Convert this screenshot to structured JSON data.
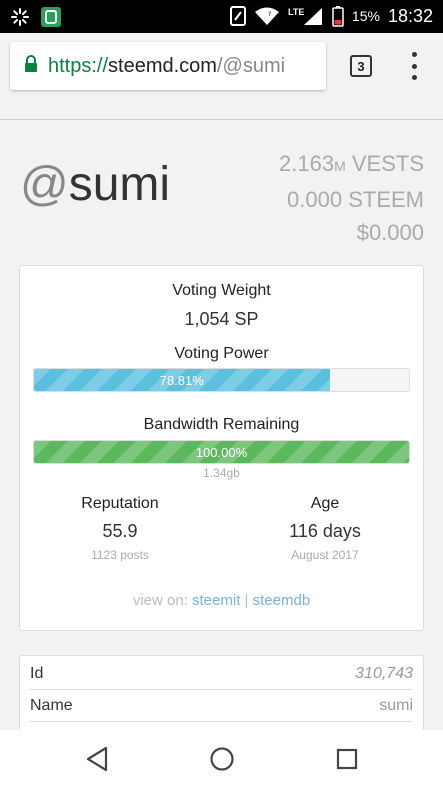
{
  "status_bar": {
    "battery_percent": "15%",
    "time": "18:32",
    "network": "LTE",
    "icons": [
      "loading-spinner-icon",
      "app-notification-icon",
      "nfc-icon",
      "wifi-icon",
      "lte-signal-icon",
      "battery-low-icon"
    ]
  },
  "browser": {
    "url_scheme": "https://",
    "url_host": "steemd.com",
    "url_path": "/@sumi",
    "tab_count": "3",
    "accent_color": "#0b8043"
  },
  "profile": {
    "at_sign": "@",
    "username": "sumi",
    "vests_value": "2.163",
    "vests_unit_small": "M",
    "vests_label": "VESTS",
    "steem": "0.000 STEEM",
    "usd": "$0.000"
  },
  "stats": {
    "voting_weight_label": "Voting Weight",
    "voting_weight_value": "1,054 SP",
    "voting_power_label": "Voting Power",
    "voting_power_text": "78.81%",
    "voting_power_fraction": 0.7881,
    "bandwidth_label": "Bandwidth Remaining",
    "bandwidth_text": "100.00%",
    "bandwidth_fraction": 1.0,
    "bandwidth_size": "1.34gb",
    "reputation_label": "Reputation",
    "reputation_value": "55.9",
    "reputation_sub": "1123 posts",
    "age_label": "Age",
    "age_value": "116 days",
    "age_sub": "August 2017",
    "view_on_prefix": "view on:",
    "link_steemit": "steemit",
    "separator": "|",
    "link_steemdb": "steemdb",
    "bar_colors": {
      "voting_power": "#5bc0de",
      "bandwidth": "#5cb85c"
    }
  },
  "info_table": {
    "rows": [
      {
        "key": "Id",
        "value": "310,743"
      },
      {
        "key": "Name",
        "value": "sumi"
      }
    ]
  },
  "nav": {
    "back": "back-triangle-icon",
    "home": "home-circle-icon",
    "recents": "recents-square-icon"
  }
}
